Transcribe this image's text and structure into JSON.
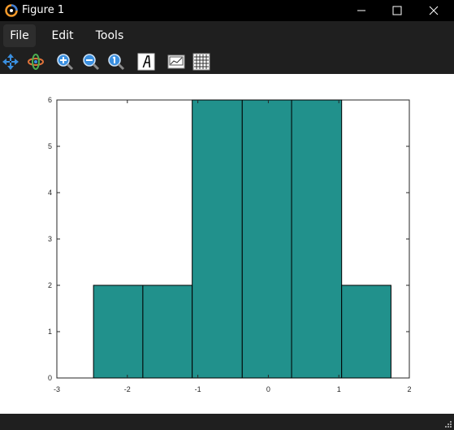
{
  "window": {
    "title": "Figure 1"
  },
  "menu": {
    "items": [
      {
        "label": "File"
      },
      {
        "label": "Edit"
      },
      {
        "label": "Tools"
      }
    ]
  },
  "toolbar": {
    "tools": [
      {
        "icon": "pan-icon"
      },
      {
        "icon": "rotate-icon"
      },
      {
        "icon": "zoom-in-icon"
      },
      {
        "icon": "zoom-out-icon"
      },
      {
        "icon": "zoom-reset-icon"
      },
      {
        "icon": "text-annotation-icon"
      },
      {
        "icon": "axes-icon"
      },
      {
        "icon": "grid-icon"
      }
    ]
  },
  "colors": {
    "bar_fill": "#21918c",
    "bar_edge": "#000000",
    "titlebar_bg": "#000000",
    "chrome_bg": "#1f1f1f"
  },
  "chart_data": {
    "type": "bar",
    "subtype": "histogram",
    "bins": [
      {
        "from": -2.48,
        "to": -1.78,
        "count": 2
      },
      {
        "from": -1.78,
        "to": -1.08,
        "count": 2
      },
      {
        "from": -1.08,
        "to": -0.37,
        "count": 6
      },
      {
        "from": -0.37,
        "to": 0.33,
        "count": 6
      },
      {
        "from": 0.33,
        "to": 1.04,
        "count": 6
      },
      {
        "from": 1.04,
        "to": 1.74,
        "count": 2
      }
    ],
    "xlim": [
      -3,
      2
    ],
    "ylim": [
      0,
      6
    ],
    "xticks": [
      "-3",
      "-2",
      "-1",
      "0",
      "1",
      "2"
    ],
    "yticks": [
      "0",
      "1",
      "2",
      "3",
      "4",
      "5",
      "6"
    ],
    "title": "",
    "xlabel": "",
    "ylabel": "",
    "grid": false
  }
}
